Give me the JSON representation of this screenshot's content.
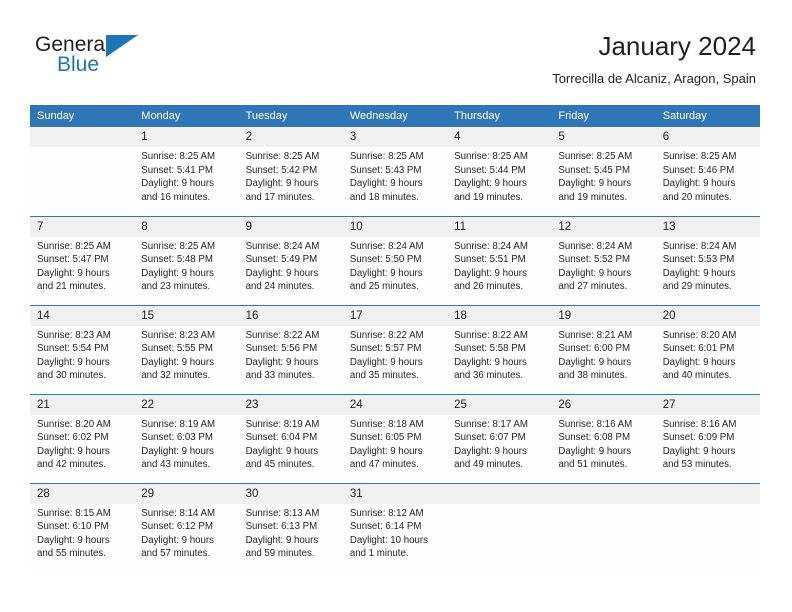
{
  "brand": {
    "name_part1": "General",
    "name_part2": "Blue",
    "logo_icon": "triangle-icon",
    "color_primary": "#1b75bb",
    "color_text": "#231f20"
  },
  "header": {
    "title": "January 2024",
    "subtitle": "Torrecilla de Alcaniz, Aragon, Spain"
  },
  "calendar": {
    "header_background": "#2e76b8",
    "daynum_background": "#f0f0f0",
    "weekdays": [
      "Sunday",
      "Monday",
      "Tuesday",
      "Wednesday",
      "Thursday",
      "Friday",
      "Saturday"
    ],
    "weeks": [
      [
        {
          "day": "",
          "sunrise": "",
          "sunset": "",
          "daylight": "",
          "empty": true
        },
        {
          "day": "1",
          "sunrise": "Sunrise: 8:25 AM",
          "sunset": "Sunset: 5:41 PM",
          "daylight": "Daylight: 9 hours and 16 minutes.",
          "empty": false
        },
        {
          "day": "2",
          "sunrise": "Sunrise: 8:25 AM",
          "sunset": "Sunset: 5:42 PM",
          "daylight": "Daylight: 9 hours and 17 minutes.",
          "empty": false
        },
        {
          "day": "3",
          "sunrise": "Sunrise: 8:25 AM",
          "sunset": "Sunset: 5:43 PM",
          "daylight": "Daylight: 9 hours and 18 minutes.",
          "empty": false
        },
        {
          "day": "4",
          "sunrise": "Sunrise: 8:25 AM",
          "sunset": "Sunset: 5:44 PM",
          "daylight": "Daylight: 9 hours and 19 minutes.",
          "empty": false
        },
        {
          "day": "5",
          "sunrise": "Sunrise: 8:25 AM",
          "sunset": "Sunset: 5:45 PM",
          "daylight": "Daylight: 9 hours and 19 minutes.",
          "empty": false
        },
        {
          "day": "6",
          "sunrise": "Sunrise: 8:25 AM",
          "sunset": "Sunset: 5:46 PM",
          "daylight": "Daylight: 9 hours and 20 minutes.",
          "empty": false
        }
      ],
      [
        {
          "day": "7",
          "sunrise": "Sunrise: 8:25 AM",
          "sunset": "Sunset: 5:47 PM",
          "daylight": "Daylight: 9 hours and 21 minutes.",
          "empty": false
        },
        {
          "day": "8",
          "sunrise": "Sunrise: 8:25 AM",
          "sunset": "Sunset: 5:48 PM",
          "daylight": "Daylight: 9 hours and 23 minutes.",
          "empty": false
        },
        {
          "day": "9",
          "sunrise": "Sunrise: 8:24 AM",
          "sunset": "Sunset: 5:49 PM",
          "daylight": "Daylight: 9 hours and 24 minutes.",
          "empty": false
        },
        {
          "day": "10",
          "sunrise": "Sunrise: 8:24 AM",
          "sunset": "Sunset: 5:50 PM",
          "daylight": "Daylight: 9 hours and 25 minutes.",
          "empty": false
        },
        {
          "day": "11",
          "sunrise": "Sunrise: 8:24 AM",
          "sunset": "Sunset: 5:51 PM",
          "daylight": "Daylight: 9 hours and 26 minutes.",
          "empty": false
        },
        {
          "day": "12",
          "sunrise": "Sunrise: 8:24 AM",
          "sunset": "Sunset: 5:52 PM",
          "daylight": "Daylight: 9 hours and 27 minutes.",
          "empty": false
        },
        {
          "day": "13",
          "sunrise": "Sunrise: 8:24 AM",
          "sunset": "Sunset: 5:53 PM",
          "daylight": "Daylight: 9 hours and 29 minutes.",
          "empty": false
        }
      ],
      [
        {
          "day": "14",
          "sunrise": "Sunrise: 8:23 AM",
          "sunset": "Sunset: 5:54 PM",
          "daylight": "Daylight: 9 hours and 30 minutes.",
          "empty": false
        },
        {
          "day": "15",
          "sunrise": "Sunrise: 8:23 AM",
          "sunset": "Sunset: 5:55 PM",
          "daylight": "Daylight: 9 hours and 32 minutes.",
          "empty": false
        },
        {
          "day": "16",
          "sunrise": "Sunrise: 8:22 AM",
          "sunset": "Sunset: 5:56 PM",
          "daylight": "Daylight: 9 hours and 33 minutes.",
          "empty": false
        },
        {
          "day": "17",
          "sunrise": "Sunrise: 8:22 AM",
          "sunset": "Sunset: 5:57 PM",
          "daylight": "Daylight: 9 hours and 35 minutes.",
          "empty": false
        },
        {
          "day": "18",
          "sunrise": "Sunrise: 8:22 AM",
          "sunset": "Sunset: 5:58 PM",
          "daylight": "Daylight: 9 hours and 36 minutes.",
          "empty": false
        },
        {
          "day": "19",
          "sunrise": "Sunrise: 8:21 AM",
          "sunset": "Sunset: 6:00 PM",
          "daylight": "Daylight: 9 hours and 38 minutes.",
          "empty": false
        },
        {
          "day": "20",
          "sunrise": "Sunrise: 8:20 AM",
          "sunset": "Sunset: 6:01 PM",
          "daylight": "Daylight: 9 hours and 40 minutes.",
          "empty": false
        }
      ],
      [
        {
          "day": "21",
          "sunrise": "Sunrise: 8:20 AM",
          "sunset": "Sunset: 6:02 PM",
          "daylight": "Daylight: 9 hours and 42 minutes.",
          "empty": false
        },
        {
          "day": "22",
          "sunrise": "Sunrise: 8:19 AM",
          "sunset": "Sunset: 6:03 PM",
          "daylight": "Daylight: 9 hours and 43 minutes.",
          "empty": false
        },
        {
          "day": "23",
          "sunrise": "Sunrise: 8:19 AM",
          "sunset": "Sunset: 6:04 PM",
          "daylight": "Daylight: 9 hours and 45 minutes.",
          "empty": false
        },
        {
          "day": "24",
          "sunrise": "Sunrise: 8:18 AM",
          "sunset": "Sunset: 6:05 PM",
          "daylight": "Daylight: 9 hours and 47 minutes.",
          "empty": false
        },
        {
          "day": "25",
          "sunrise": "Sunrise: 8:17 AM",
          "sunset": "Sunset: 6:07 PM",
          "daylight": "Daylight: 9 hours and 49 minutes.",
          "empty": false
        },
        {
          "day": "26",
          "sunrise": "Sunrise: 8:16 AM",
          "sunset": "Sunset: 6:08 PM",
          "daylight": "Daylight: 9 hours and 51 minutes.",
          "empty": false
        },
        {
          "day": "27",
          "sunrise": "Sunrise: 8:16 AM",
          "sunset": "Sunset: 6:09 PM",
          "daylight": "Daylight: 9 hours and 53 minutes.",
          "empty": false
        }
      ],
      [
        {
          "day": "28",
          "sunrise": "Sunrise: 8:15 AM",
          "sunset": "Sunset: 6:10 PM",
          "daylight": "Daylight: 9 hours and 55 minutes.",
          "empty": false
        },
        {
          "day": "29",
          "sunrise": "Sunrise: 8:14 AM",
          "sunset": "Sunset: 6:12 PM",
          "daylight": "Daylight: 9 hours and 57 minutes.",
          "empty": false
        },
        {
          "day": "30",
          "sunrise": "Sunrise: 8:13 AM",
          "sunset": "Sunset: 6:13 PM",
          "daylight": "Daylight: 9 hours and 59 minutes.",
          "empty": false
        },
        {
          "day": "31",
          "sunrise": "Sunrise: 8:12 AM",
          "sunset": "Sunset: 6:14 PM",
          "daylight": "Daylight: 10 hours and 1 minute.",
          "empty": false
        },
        {
          "day": "",
          "sunrise": "",
          "sunset": "",
          "daylight": "",
          "empty": true
        },
        {
          "day": "",
          "sunrise": "",
          "sunset": "",
          "daylight": "",
          "empty": true
        },
        {
          "day": "",
          "sunrise": "",
          "sunset": "",
          "daylight": "",
          "empty": true
        }
      ]
    ]
  }
}
